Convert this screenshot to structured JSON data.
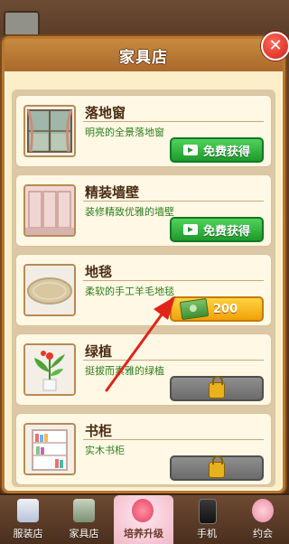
{
  "panel": {
    "title": "家具店",
    "close_label": "✕"
  },
  "items": [
    {
      "name": "落地窗",
      "desc": "明亮的全景落地窗",
      "action": "video",
      "button_label": "免费获得"
    },
    {
      "name": "精装墙壁",
      "desc": "装修精致优雅的墙壁",
      "action": "video",
      "button_label": "免费获得"
    },
    {
      "name": "地毯",
      "desc": "柔软的手工羊毛地毯",
      "action": "buy",
      "button_label": "200"
    },
    {
      "name": "绿植",
      "desc": "挺拔而素雅的绿植",
      "action": "locked",
      "button_label": ""
    },
    {
      "name": "书柜",
      "desc": "实木书柜",
      "action": "locked",
      "button_label": ""
    }
  ],
  "nav": [
    {
      "label": "服装店",
      "icon": "clothes-icon",
      "active": false
    },
    {
      "label": "家具店",
      "icon": "furniture-icon",
      "active": false
    },
    {
      "label": "培养升级",
      "icon": "heart-icon",
      "active": true
    },
    {
      "label": "手机",
      "icon": "phone-icon",
      "active": false
    },
    {
      "label": "约会",
      "icon": "flower-icon",
      "active": false
    }
  ],
  "colors": {
    "accent_green": "#1e9a2c",
    "accent_gold": "#f1a10a",
    "pointer_red": "#e2231a"
  }
}
